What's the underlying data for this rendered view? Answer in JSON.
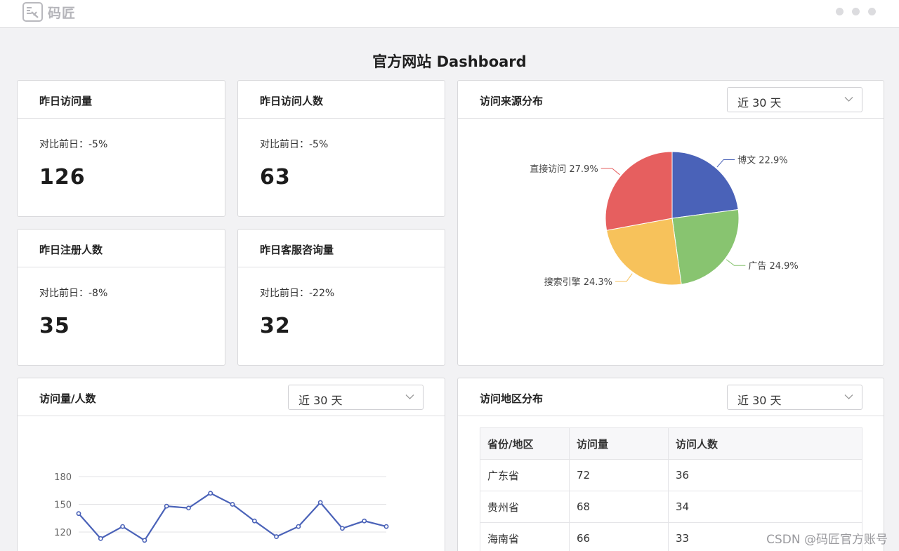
{
  "brand": {
    "name": "码匠"
  },
  "page": {
    "title": "官方网站 Dashboard"
  },
  "stats": [
    {
      "title": "昨日访问量",
      "compare": "对比前日：-5%",
      "value": "126"
    },
    {
      "title": "昨日访问人数",
      "compare": "对比前日：-5%",
      "value": "63"
    },
    {
      "title": "昨日注册人数",
      "compare": "对比前日：-8%",
      "value": "35"
    },
    {
      "title": "昨日客服咨询量",
      "compare": "对比前日：-22%",
      "value": "32"
    }
  ],
  "source_panel": {
    "title": "访问来源分布",
    "range": "近 30 天"
  },
  "trend_panel": {
    "title": "访问量/人数",
    "range": "近 30 天"
  },
  "region_panel": {
    "title": "访问地区分布",
    "range": "近 30 天",
    "columns": [
      "省份/地区",
      "访问量",
      "访问人数"
    ],
    "rows": [
      [
        "广东省",
        "72",
        "36"
      ],
      [
        "贵州省",
        "68",
        "34"
      ],
      [
        "海南省",
        "66",
        "33"
      ]
    ]
  },
  "chart_data": [
    {
      "type": "pie",
      "slices": [
        {
          "label": "博文 22.9%",
          "name": "博文",
          "value": 22.9,
          "color": "#4a62b8"
        },
        {
          "label": "广告 24.9%",
          "name": "广告",
          "value": 24.9,
          "color": "#88c470"
        },
        {
          "label": "搜索引擎 24.3%",
          "name": "搜索引擎",
          "value": 24.3,
          "color": "#f7c25b"
        },
        {
          "label": "直接访问 27.9%",
          "name": "直接访问",
          "value": 27.9,
          "color": "#e65f5f"
        }
      ]
    },
    {
      "type": "line",
      "y_ticks": [
        "180",
        "150",
        "120"
      ],
      "ylim": [
        120,
        180
      ],
      "grid": true,
      "color": "#4a62b8",
      "values": [
        140,
        113,
        126,
        111,
        148,
        146,
        162,
        150,
        132,
        115,
        126,
        152,
        124,
        132,
        126
      ]
    }
  ],
  "watermark": "CSDN @码匠官方账号"
}
